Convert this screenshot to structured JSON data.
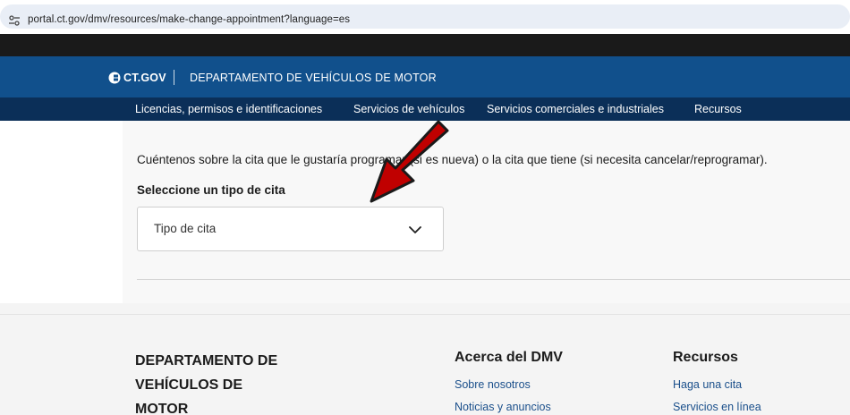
{
  "browser": {
    "url": "portal.ct.gov/dmv/resources/make-change-appointment?language=es",
    "site_info_icon": "tune-icon"
  },
  "header": {
    "logo_text": "CT.GOV",
    "department": "DEPARTAMENTO DE VEHÍCULOS DE MOTOR",
    "brand_color": "#11508c"
  },
  "nav": {
    "items": [
      {
        "label": "Licencias, permisos e identificaciones"
      },
      {
        "label": "Servicios de vehículos"
      },
      {
        "label": "Servicios comerciales e industriales"
      },
      {
        "label": "Recursos"
      }
    ],
    "bg_color": "#0b2f58"
  },
  "main": {
    "intro": "Cuéntenos sobre la cita que le gustaría programar (si es nueva) o la cita que tiene (si necesita cancelar/reprogramar).",
    "select_label": "Seleccione un tipo de cita",
    "select_value": "Tipo de cita",
    "select_icon": "chevron-down-icon"
  },
  "annotation": {
    "arrow_color": "#c00000"
  },
  "footer": {
    "brand_lines": [
      "DEPARTAMENTO DE",
      "VEHÍCULOS DE",
      "MOTOR"
    ],
    "columns": [
      {
        "heading": "Acerca del DMV",
        "links": [
          "Sobre nosotros",
          "Noticias y anuncios"
        ]
      },
      {
        "heading": "Recursos",
        "links": [
          "Haga una cita",
          "Servicios en línea"
        ]
      }
    ]
  }
}
